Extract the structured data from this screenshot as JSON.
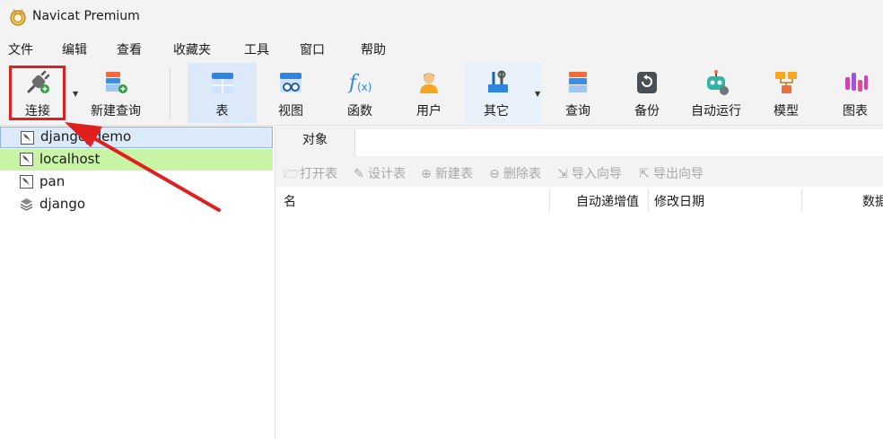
{
  "window": {
    "title": "Navicat Premium"
  },
  "menu": [
    "文件",
    "编辑",
    "查看",
    "收藏夹",
    "工具",
    "窗口",
    "帮助"
  ],
  "toolbar": {
    "connect": "连接",
    "new_query": "新建查询",
    "table": "表",
    "view": "视图",
    "function": "函数",
    "user": "用户",
    "others": "其它",
    "query": "查询",
    "backup": "备份",
    "automation": "自动运行",
    "model": "模型",
    "chart": "图表"
  },
  "connections": [
    {
      "label": "django_demo",
      "state": "selected"
    },
    {
      "label": "localhost",
      "state": "highlighted"
    },
    {
      "label": "pan",
      "state": "normal"
    },
    {
      "label": "django",
      "state": "normal"
    }
  ],
  "tabs": {
    "objects": "对象"
  },
  "object_toolbar": {
    "open_table": "打开表",
    "design_table": "设计表",
    "new_table": "新建表",
    "delete_table": "删除表",
    "import_wizard": "导入向导",
    "export_wizard": "导出向导"
  },
  "columns": {
    "name": "名",
    "auto_increment": "自动递增值",
    "modified_date": "修改日期",
    "data": "数据"
  },
  "colors": {
    "selected_bg": "#dbe9f9",
    "highlight_green": "#c8f5a5",
    "annotation_red": "#e02020"
  }
}
